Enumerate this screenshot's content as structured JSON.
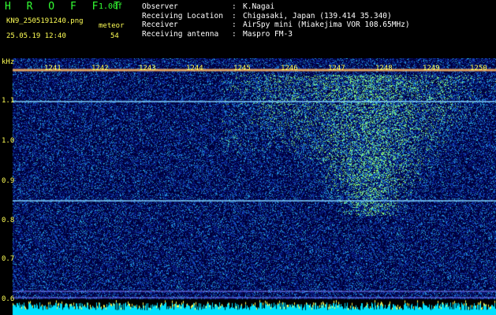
{
  "header": {
    "app_title": "H R O F F T",
    "version": "1.00f",
    "filename": "KN9_2505191240.png",
    "datetime": "25.05.19 12:40",
    "meteor_label": "meteor",
    "meteor_count": "54",
    "info": [
      {
        "key": "Observer",
        "value": "K.Nagai"
      },
      {
        "key": "Receiving Location",
        "value": "Chigasaki, Japan (139.414 35.340)"
      },
      {
        "key": "Receiver",
        "value": "AirSpy mini (Miakejima VOR 108.65MHz)"
      },
      {
        "key": "Receiving antenna",
        "value": "Maspro FM-3"
      }
    ]
  },
  "plot": {
    "y_unit": "kHz",
    "y_ticks": [
      "1.1",
      "1.0",
      "0.9",
      "0.8",
      "0.7",
      "0.6"
    ],
    "x_ticks": [
      "1241",
      "1242",
      "1243",
      "1244",
      "1245",
      "1246",
      "1247",
      "1248",
      "1249",
      "1250"
    ]
  },
  "colors": {
    "background": "#00003a",
    "label": "#ffff55",
    "title": "#33ff33",
    "level": "#00e0ff"
  }
}
